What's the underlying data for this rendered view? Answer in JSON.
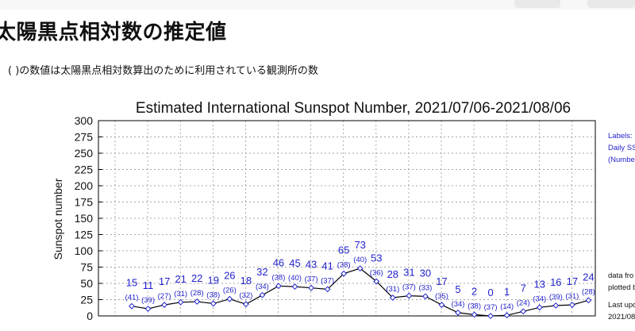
{
  "page": {
    "heading": "太陽黒点相対数の推定値",
    "note": "( )の数値は太陽黒点相対数算出のために利用されている観測所の数"
  },
  "chart_data": {
    "type": "line",
    "title": "Estimated International Sunspot Number, 2021/07/06-2021/08/06",
    "ylabel": "Sunspot number",
    "xlabel": "",
    "ylim": [
      0,
      300
    ],
    "yticks": [
      0,
      25,
      50,
      75,
      100,
      125,
      150,
      175,
      200,
      225,
      250,
      275,
      300
    ],
    "grid": true,
    "color": "#2222cc",
    "series": [
      {
        "values": [
          15,
          11,
          17,
          21,
          22,
          19,
          26,
          18,
          32,
          46,
          45,
          43,
          41,
          65,
          73,
          53,
          28,
          31,
          30,
          17,
          5,
          2,
          0,
          1,
          7,
          13,
          16,
          17,
          24
        ],
        "stations": [
          41,
          39,
          27,
          31,
          28,
          38,
          26,
          32,
          34,
          38,
          40,
          37,
          37,
          38,
          40,
          36,
          31,
          37,
          33,
          35,
          34,
          38,
          37,
          14,
          24,
          34,
          39,
          31,
          28
        ]
      }
    ],
    "side_labels": {
      "legend_lines": [
        "Labels:",
        "Daily SS",
        "(Numbe"
      ],
      "data_lines": [
        "data fro",
        "plotted b"
      ],
      "update_lines": [
        "Last upd",
        "2021/08"
      ]
    }
  }
}
